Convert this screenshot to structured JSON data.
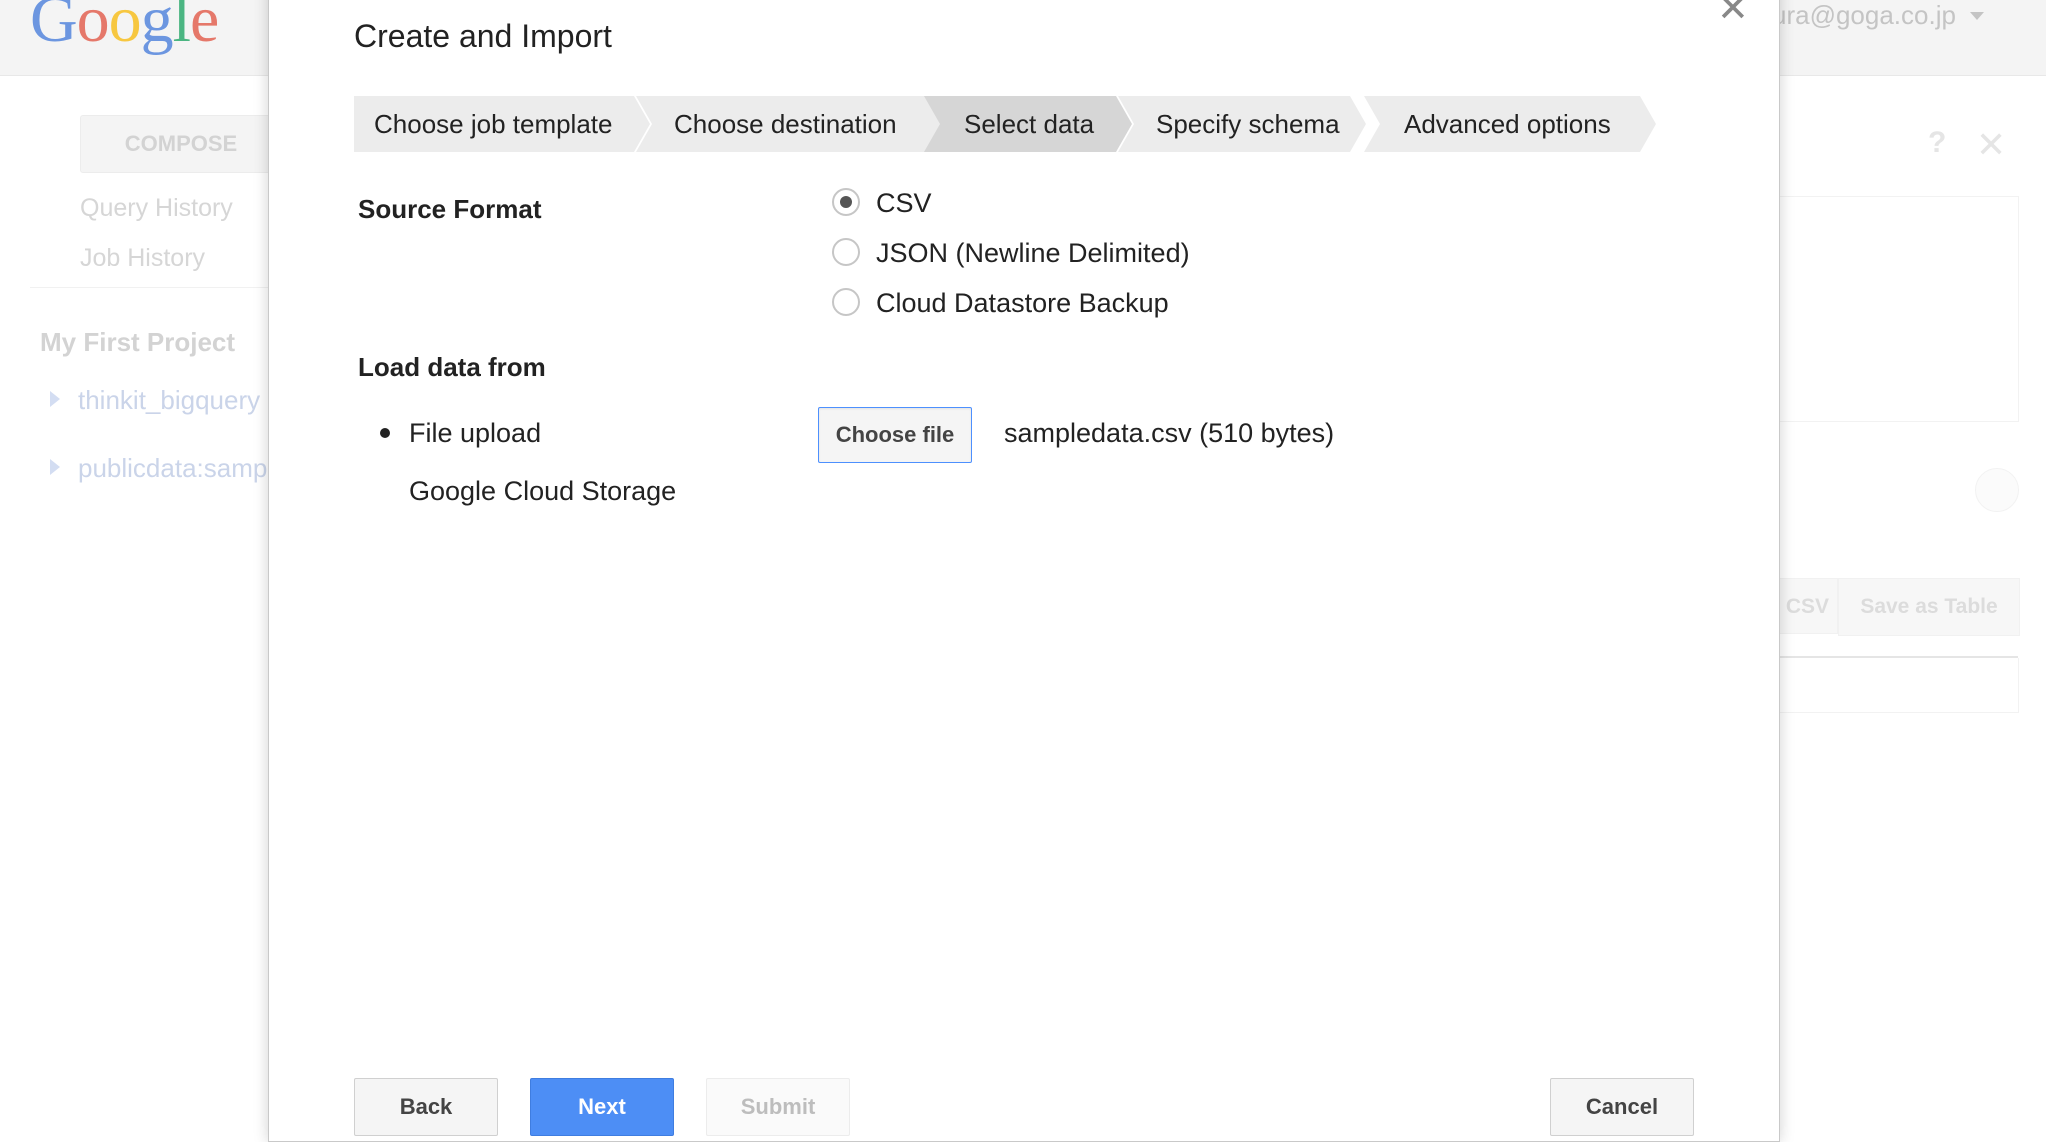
{
  "background": {
    "logo_text": "Google",
    "user_email": "ura@goga.co.jp",
    "compose_label": "COMPOSE",
    "sidebar_links": [
      "Query History",
      "Job History"
    ],
    "project_title": "My First Project",
    "datasets": [
      "thinkit_bigquery",
      "publicdata:samp"
    ],
    "help_icon_text": "?",
    "close_icon_text": "✕",
    "result_tabs": [
      "CSV",
      "Save as Table"
    ]
  },
  "dialog": {
    "title": "Create and Import",
    "close_glyph": "✕",
    "steps": [
      {
        "label": "Choose job template",
        "active": false
      },
      {
        "label": "Choose destination",
        "active": false
      },
      {
        "label": "Select data",
        "active": true
      },
      {
        "label": "Specify schema",
        "active": false
      },
      {
        "label": "Advanced options",
        "active": false
      }
    ],
    "source_format": {
      "label": "Source Format",
      "options": [
        {
          "label": "CSV",
          "checked": true
        },
        {
          "label": "JSON (Newline Delimited)",
          "checked": false
        },
        {
          "label": "Cloud Datastore Backup",
          "checked": false
        }
      ]
    },
    "load_data": {
      "label": "Load data from",
      "options": [
        {
          "label": "File upload",
          "selected": true
        },
        {
          "label": "Google Cloud Storage",
          "selected": false
        }
      ],
      "choose_file_label": "Choose file",
      "file_name": "sampledata.csv (510 bytes)"
    },
    "buttons": {
      "back": "Back",
      "next": "Next",
      "submit": "Submit",
      "cancel": "Cancel"
    }
  },
  "colors": {
    "accent_blue": "#4d8ef5",
    "step_bg": "#ececec",
    "step_active_bg": "#d6d6d6"
  }
}
